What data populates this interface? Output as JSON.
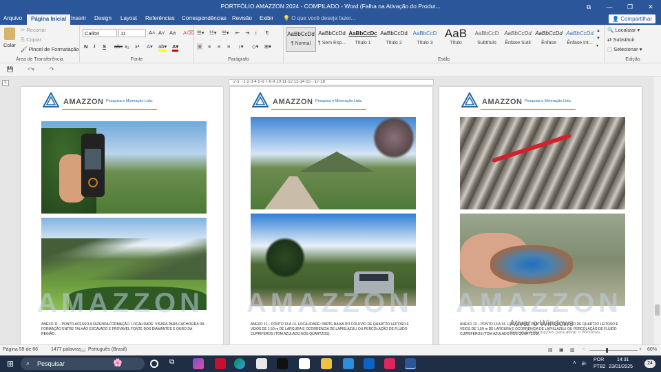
{
  "window": {
    "title": "PORTFÓLIO AMAZZON 2024 - COMPILADO  -  Word (Falha na Ativação do Produt...",
    "buttons": [
      "⧉",
      "—",
      "❐",
      "✕"
    ]
  },
  "tabs": [
    "Arquivo",
    "Página Inicial",
    "Inserir",
    "Design",
    "Layout",
    "Referências",
    "Correspondências",
    "Revisão",
    "Exibir"
  ],
  "tell_me": "O que você deseja fazer...",
  "share_label": "Compartilhar",
  "clipboard": {
    "paste": "Colar",
    "cut": "Recortar",
    "copy": "Copiar",
    "format_painter": "Pincel de Formatação",
    "label": "Área de Transferência"
  },
  "font": {
    "family": "Calibri",
    "size": "11",
    "buttons": [
      "N",
      "I",
      "S",
      "abc",
      "x₂",
      "x²"
    ],
    "label": "Fonte"
  },
  "paragraph": {
    "label": "Parágrafo"
  },
  "styles": {
    "label": "Estilo",
    "items": [
      {
        "preview": "AaBbCcDd",
        "name": "¶ Normal"
      },
      {
        "preview": "AaBbCcDd",
        "name": "¶ Sem Esp..."
      },
      {
        "preview": "AaBbCcDc",
        "name": "Título 1"
      },
      {
        "preview": "AaBbCcDd",
        "name": "Título 2"
      },
      {
        "preview": "AaBbCcD",
        "name": "Título 3"
      },
      {
        "preview": "AaB",
        "name": "Título"
      },
      {
        "preview": "AaBbCcD",
        "name": "Subtítulo"
      },
      {
        "preview": "AaBbCcDd",
        "name": "Ênfase Sutil"
      },
      {
        "preview": "AaBbCcDd",
        "name": "Ênfase"
      },
      {
        "preview": "AaBbCcDd",
        "name": "Ênfase Int..."
      }
    ]
  },
  "editing": {
    "find": "Localizar",
    "replace": "Substituir",
    "select": "Selecionar",
    "label": "Edição"
  },
  "ruler_text": "·2·1·  ·1·2·3·4·5·6·7·8·9·10·11·12·13·14·15· ·17·18",
  "pages": [
    {
      "logo_name": "AMAZZON",
      "logo_sub": "Pesquisa e Mineração Ltda.",
      "caption": "ANEXO 11 – PONTO ACESSO A FAZENDA FORMAÇÃO. LOCALIDADE: VISADA PARA CACHOEIRA DA FORMAÇÃO ENTRE TALHÃO ESCAVADO E PROVAVEL FONTE DOS DIAMANTES E OURO DA REGIÃO."
    },
    {
      "logo_name": "AMAZZON",
      "logo_sub": "Pesquisa e Mineração Ltda.",
      "caption": "ANEXO 12 – PONTO 13 A 14- LOCALIDADE: PARTE BAIXA DO COLÚVIO DE QUARTZO LEITOSO E VEIOS DE 1,50 m DE LARGURA E OCORRENCIA DE LAPISLAZULI OU PERCOLAÇÃO DE FLUIDO CUPRIFEROS (TOM AZULADO NOS QUARTZOS)."
    },
    {
      "logo_name": "AMAZZON",
      "logo_sub": "Pesquisa e Mineração Ltda.",
      "caption": "ANEXO 13 – PONTO 13 A 14- LOCALIDADE: PARTE BAIXA DO COLÚVIO DE QUARTZO LEITOSO E VEIOS DE 1,50 m DE LARGURA E OCORRENCIA DE LAPISLAZULI OU PERCOLAÇÃO DE FLUIDO CUPRIFEROS (TOM AZULADO NOS QUARTZOS)."
    }
  ],
  "watermark": "AMAZZON",
  "activate": {
    "title": "Ativar o Windows",
    "sub": "Acesse Configurações para ativar o Windows."
  },
  "status": {
    "page": "Página 59 de 66",
    "words": "1477 palavras",
    "language": "Português (Brasil)",
    "zoom": "60%"
  },
  "taskbar": {
    "search": "Pesquisar",
    "lang1": "POR",
    "lang2": "PTB2",
    "time": "14:31",
    "date": "23/01/2025",
    "notifications": "24"
  }
}
